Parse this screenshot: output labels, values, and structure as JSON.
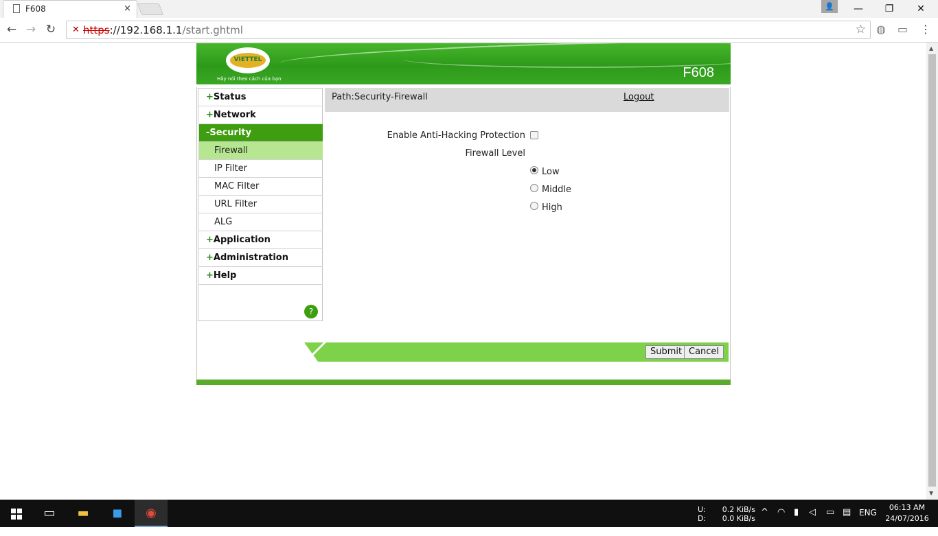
{
  "browser": {
    "tab_title": "F608",
    "tab_close": "×",
    "url_protocol": "https",
    "url_host": "://192.168.1.1",
    "url_path": "/start.ghtml",
    "security_mark": "✕",
    "win_min": "—",
    "win_restore": "❐",
    "win_close": "✕",
    "back": "←",
    "forward": "→",
    "reload": "↻",
    "star": "☆",
    "menu": "⋮"
  },
  "banner": {
    "logo_text": "VIETTEL",
    "slogan": "Hãy nói theo cách của bạn",
    "model": "F608"
  },
  "menu": {
    "items": [
      {
        "prefix": "+",
        "label": "Status"
      },
      {
        "prefix": "+",
        "label": "Network"
      },
      {
        "prefix": "-",
        "label": "Security"
      },
      {
        "prefix": "+",
        "label": "Application"
      },
      {
        "prefix": "+",
        "label": "Administration"
      },
      {
        "prefix": "+",
        "label": "Help"
      }
    ],
    "sub_items": [
      {
        "label": "Firewall"
      },
      {
        "label": "IP Filter"
      },
      {
        "label": "MAC Filter"
      },
      {
        "label": "URL Filter"
      },
      {
        "label": "ALG"
      }
    ],
    "help_glyph": "?"
  },
  "pathbar": {
    "path": "Path:Security-Firewall",
    "logout": "Logout"
  },
  "form": {
    "anti_hacking_label": "Enable Anti-Hacking Protection",
    "anti_hacking_checked": false,
    "firewall_level_label": "Firewall Level",
    "levels": [
      {
        "label": "Low",
        "selected": true
      },
      {
        "label": "Middle",
        "selected": false
      },
      {
        "label": "High",
        "selected": false
      }
    ],
    "submit": "Submit",
    "cancel": "Cancel"
  },
  "taskbar": {
    "net_up_label": "U:",
    "net_down_label": "D:",
    "net_up": "0.2 KiB/s",
    "net_down": "0.0 KiB/s",
    "lang": "ENG",
    "time": "06:13 AM",
    "date": "24/07/2016"
  },
  "colors": {
    "brand_green": "#3f9e10",
    "highlight_green": "#b6e690",
    "button_bar": "#7ed24a"
  }
}
